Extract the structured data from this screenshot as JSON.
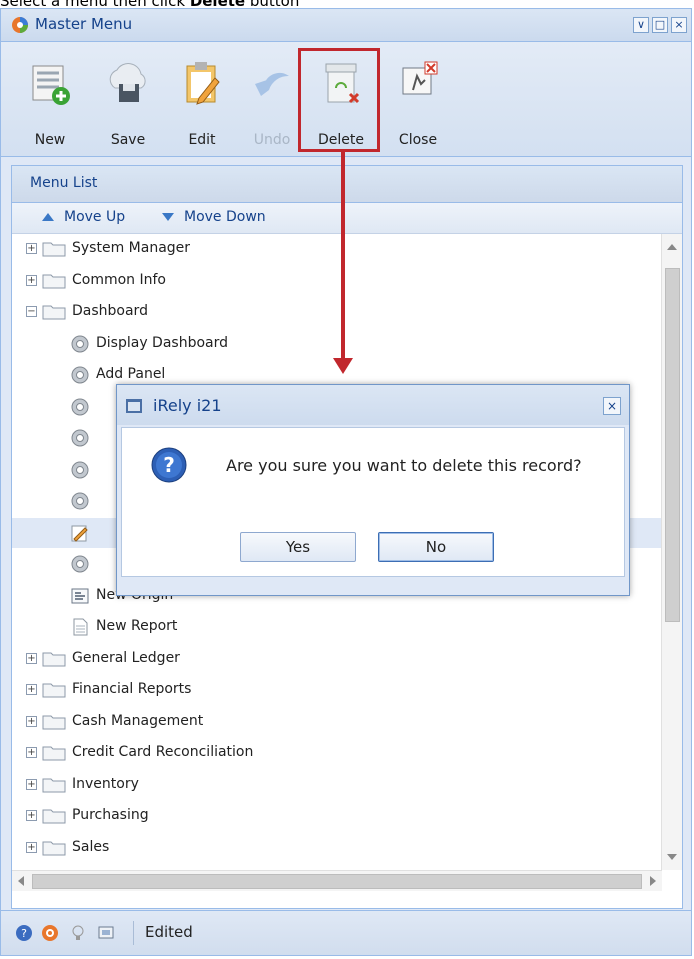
{
  "instruction": {
    "prefix": "Select a menu then click ",
    "bold": "Delete",
    "suffix": " button"
  },
  "window": {
    "title": "Master Menu",
    "controls": [
      "restore-icon",
      "maximize-icon",
      "close-icon"
    ]
  },
  "toolbar": {
    "buttons": [
      {
        "label": "New",
        "icon": "new-icon",
        "enabled": true
      },
      {
        "label": "Save",
        "icon": "save-icon",
        "enabled": true
      },
      {
        "label": "Edit",
        "icon": "edit-icon",
        "enabled": true
      },
      {
        "label": "Undo",
        "icon": "undo-icon",
        "enabled": false
      },
      {
        "label": "Delete",
        "icon": "delete-icon",
        "enabled": true,
        "highlighted": true
      },
      {
        "label": "Close",
        "icon": "close-icon",
        "enabled": true
      }
    ]
  },
  "panel": {
    "title": "Menu List",
    "move_up": "Move Up",
    "move_down": "Move Down"
  },
  "tree": [
    {
      "label": "System Manager",
      "kind": "folder",
      "expanded": false
    },
    {
      "label": "Common Info",
      "kind": "folder",
      "expanded": false
    },
    {
      "label": "Dashboard",
      "kind": "folder",
      "expanded": true
    },
    {
      "label": "Display Dashboard",
      "kind": "gear"
    },
    {
      "label": "Add Panel",
      "kind": "gear"
    },
    {
      "label": "",
      "kind": "gear"
    },
    {
      "label": "",
      "kind": "gear"
    },
    {
      "label": "",
      "kind": "gear"
    },
    {
      "label": "",
      "kind": "gear"
    },
    {
      "label": "",
      "kind": "edit",
      "selected": true
    },
    {
      "label": "",
      "kind": "gear"
    },
    {
      "label": "New Origin",
      "kind": "form"
    },
    {
      "label": "New Report",
      "kind": "report"
    },
    {
      "label": "General Ledger",
      "kind": "folder",
      "expanded": false
    },
    {
      "label": "Financial Reports",
      "kind": "folder",
      "expanded": false
    },
    {
      "label": "Cash Management",
      "kind": "folder",
      "expanded": false
    },
    {
      "label": "Credit Card Reconciliation",
      "kind": "folder",
      "expanded": false
    },
    {
      "label": "Inventory",
      "kind": "folder",
      "expanded": false
    },
    {
      "label": "Purchasing",
      "kind": "folder",
      "expanded": false
    },
    {
      "label": "Sales",
      "kind": "folder",
      "expanded": false
    }
  ],
  "status": {
    "text": "Edited",
    "icons": [
      "help-icon",
      "support-icon",
      "tip-icon",
      "screen-icon"
    ]
  },
  "dialog": {
    "title": "iRely i21",
    "message": "Are you sure you want to delete this record?",
    "yes_label": "Yes",
    "no_label": "No",
    "icon": "question-icon"
  },
  "colors": {
    "accent": "#15428b",
    "highlight": "#c1272d",
    "border": "#99bbe8"
  }
}
